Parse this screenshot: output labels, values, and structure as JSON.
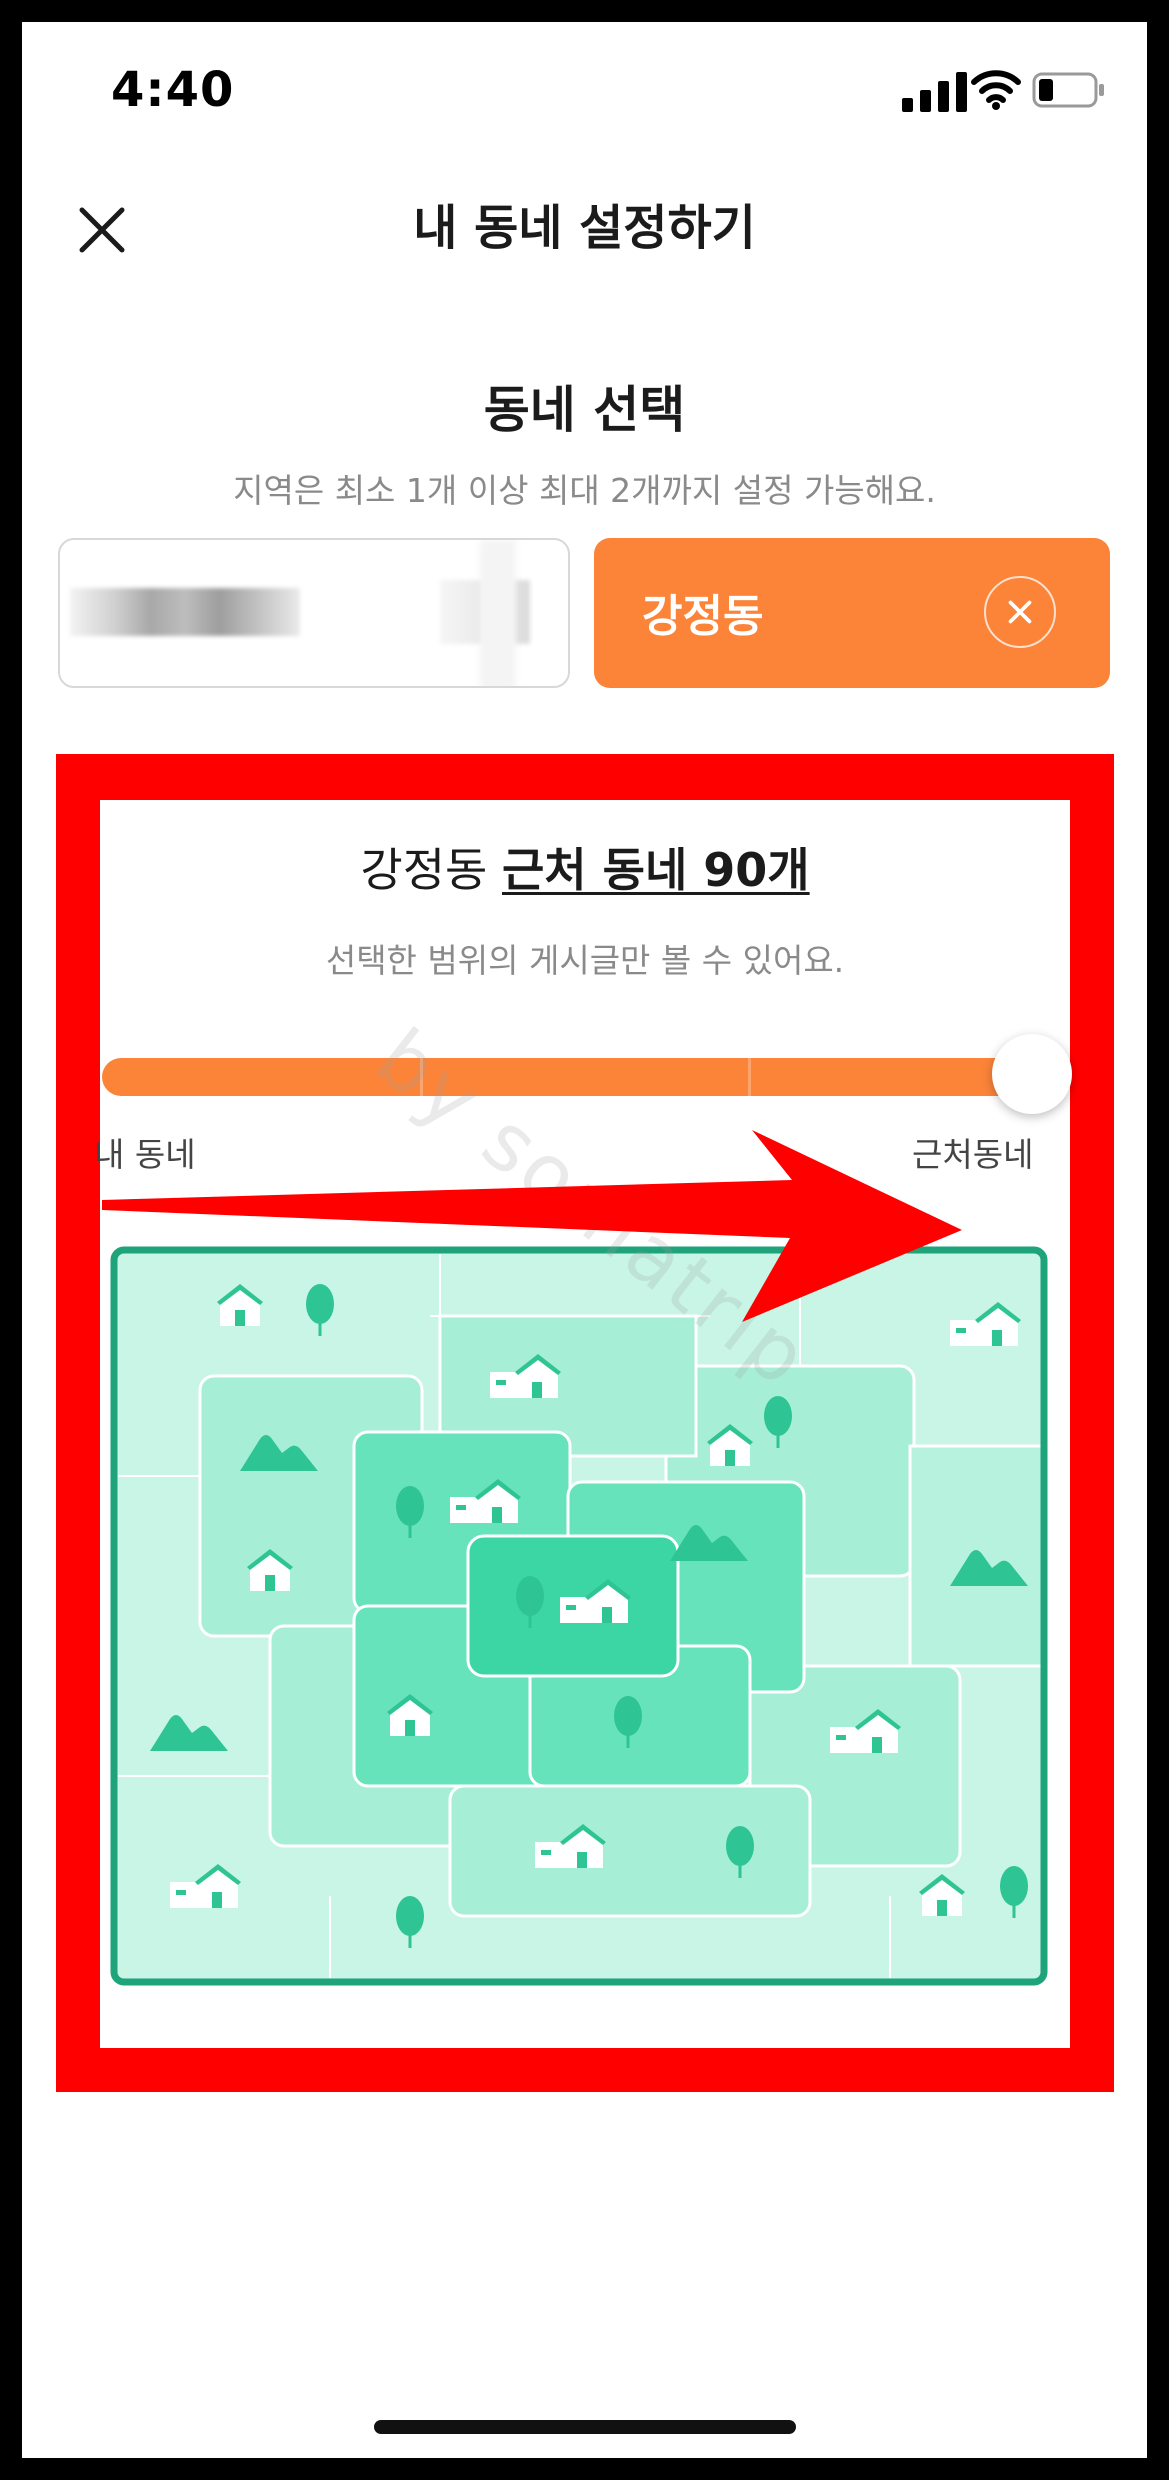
{
  "status_bar": {
    "time": "4:40"
  },
  "header": {
    "title": "내 동네 설정하기",
    "close_icon": "close-icon"
  },
  "section": {
    "title": "동네 선택",
    "subtitle": "지역은 최소 1개 이상 최대 2개까지 설정 가능해요."
  },
  "neighborhoods": [
    {
      "label": "",
      "state": "empty"
    },
    {
      "label": "강정동",
      "state": "selected",
      "remove_icon": "close-circle-icon"
    }
  ],
  "range": {
    "title_prefix": "강정동",
    "title_emph": "근처 동네 90개",
    "subtitle": "선택한 범위의 게시글만 볼 수 있어요.",
    "slider": {
      "steps": 4,
      "selected_step": 4,
      "min_label": "내 동네",
      "max_label": "근처동네"
    }
  },
  "watermark": "by somatrip",
  "colors": {
    "accent": "#fb8439",
    "highlight_frame": "#ff0000",
    "map_border": "#1ea37a",
    "arrow": "#ff0000"
  }
}
